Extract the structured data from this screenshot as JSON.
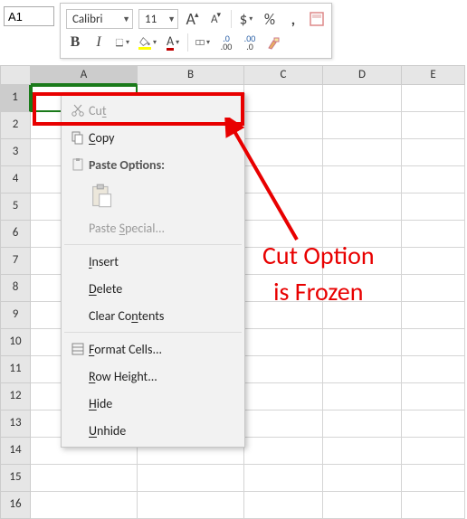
{
  "namebox": {
    "value": "A1"
  },
  "toolbar": {
    "font": "Calibri",
    "size": "11",
    "increase_font_glyph": "A",
    "decrease_font_glyph": "A",
    "currency_glyph": "$",
    "percent_glyph": "%",
    "comma_glyph": ",",
    "bold_glyph": "B",
    "italic_glyph": "I",
    "font_color_glyph": "A",
    "inc_dec_glyph1": ".0",
    "inc_dec_glyph1b": ".00",
    "inc_dec_glyph2": ".00",
    "inc_dec_glyph2b": ".0"
  },
  "columns": [
    "A",
    "B",
    "C",
    "D",
    "E"
  ],
  "rows": [
    "1",
    "2",
    "3",
    "4",
    "5",
    "6",
    "7",
    "8",
    "9",
    "10",
    "11",
    "12",
    "13",
    "14",
    "15",
    "16"
  ],
  "context_menu": {
    "cut": "Cut",
    "copy": "Copy",
    "paste_options": "Paste Options:",
    "paste_special": "Paste Special...",
    "insert": "Insert",
    "delete": "Delete",
    "clear_contents": "Clear Contents",
    "format_cells": "Format Cells...",
    "row_height": "Row Height...",
    "hide": "Hide",
    "unhide": "Unhide"
  },
  "annotation": {
    "line1": "Cut Option",
    "line2": "is Frozen"
  }
}
